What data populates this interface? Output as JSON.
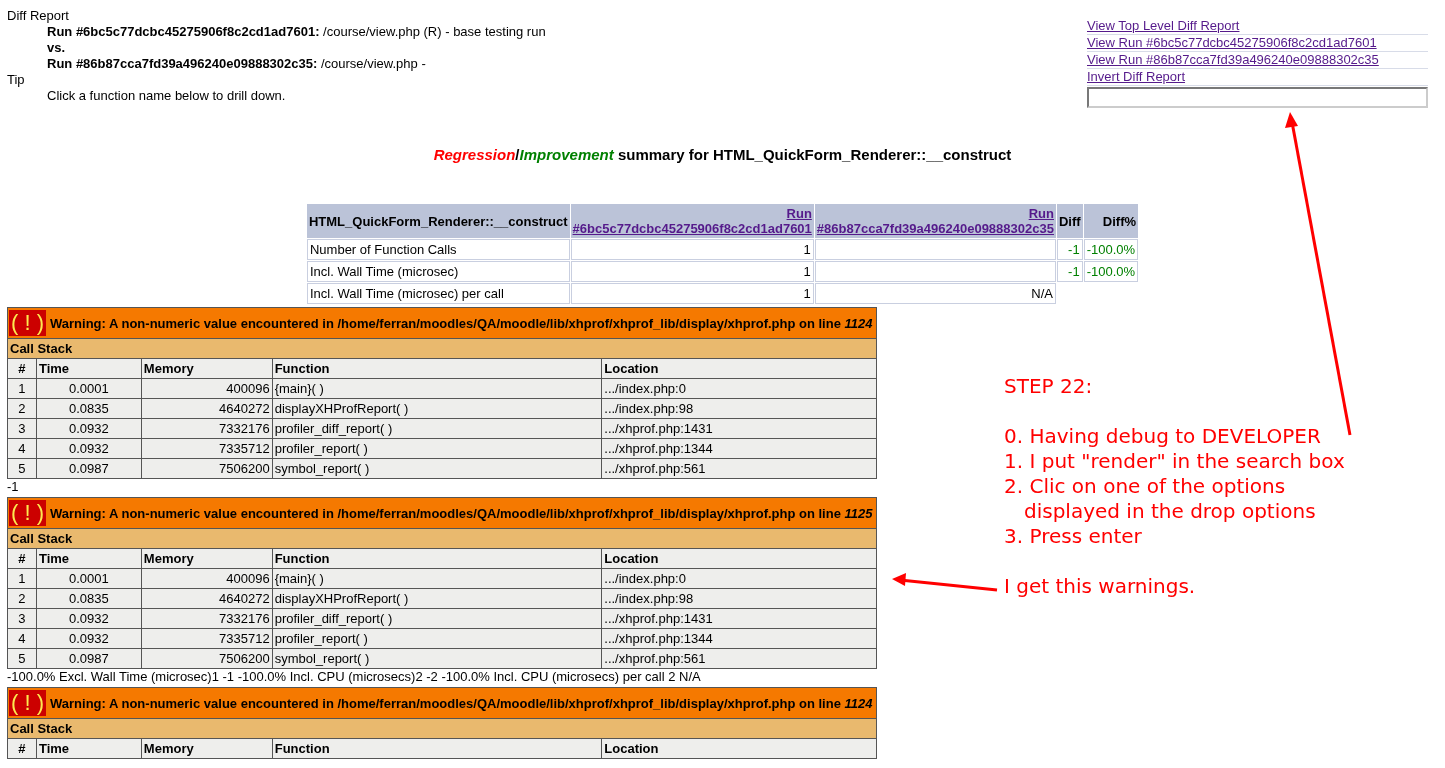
{
  "header": {
    "title": "Diff Report",
    "runs": [
      {
        "label": "Run #6bc5c77dcbc45275906f8c2cd1ad7601:",
        "detail": "/course/view.php (R) - base testing run"
      },
      {
        "label": "Run #86b87cca7fd39a496240e09888302c35:",
        "detail": "/course/view.php -"
      }
    ],
    "versus": "vs.",
    "tip_title": "Tip",
    "tip": "Click a function name below to drill down."
  },
  "nav_links": [
    "View Top Level Diff Report",
    "View Run #6bc5c77dcbc45275906f8c2cd1ad7601",
    "View Run #86b87cca7fd39a496240e09888302c35",
    "Invert Diff Report"
  ],
  "summary_title": {
    "regression": "Regression",
    "separator": "/",
    "improvement": "Improvement",
    "rest": "summary for HTML_QuickForm_Renderer::__construct"
  },
  "summary_table": {
    "columns": [
      {
        "kind": "name",
        "text": "HTML_QuickForm_Renderer::__construct"
      },
      {
        "kind": "run",
        "label": "Run",
        "link": "#6bc5c77dcbc45275906f8c2cd1ad7601"
      },
      {
        "kind": "run",
        "label": "Run",
        "link": "#86b87cca7fd39a496240e09888302c35"
      },
      {
        "kind": "plain",
        "text": "Diff"
      },
      {
        "kind": "plain",
        "text": "Diff%"
      }
    ],
    "rows": [
      [
        "Number of Function Calls",
        "1",
        "",
        "-1",
        "-100.0%"
      ],
      [
        "Incl. Wall Time (microsec)",
        "1",
        "",
        "-1",
        "-100.0%"
      ],
      [
        "Incl. Wall Time (microsec) per call",
        "1",
        "N/A"
      ]
    ]
  },
  "warnings": [
    {
      "icon": "( ! )",
      "message": "Warning: A non-numeric value encountered in /home/ferran/moodles/QA/moodle/lib/xhprof/xhprof_lib/display/xhprof.php on line *1124*",
      "stack_title": "Call Stack",
      "columns": [
        "#",
        "Time",
        "Memory",
        "Function",
        "Location"
      ],
      "rows": [
        [
          "1",
          "0.0001",
          "400096",
          "{main}( )",
          ".../index.php:0"
        ],
        [
          "2",
          "0.0835",
          "4640272",
          "displayXHProfReport( )",
          ".../index.php:98"
        ],
        [
          "3",
          "0.0932",
          "7332176",
          "profiler_diff_report( )",
          ".../xhprof.php:1431"
        ],
        [
          "4",
          "0.0932",
          "7335712",
          "profiler_report( )",
          ".../xhprof.php:1344"
        ],
        [
          "5",
          "0.0987",
          "7506200",
          "symbol_report( )",
          ".../xhprof.php:561"
        ]
      ],
      "trailing": "-1"
    },
    {
      "icon": "( ! )",
      "message": "Warning: A non-numeric value encountered in /home/ferran/moodles/QA/moodle/lib/xhprof/xhprof_lib/display/xhprof.php on line *1125*",
      "stack_title": "Call Stack",
      "columns": [
        "#",
        "Time",
        "Memory",
        "Function",
        "Location"
      ],
      "rows": [
        [
          "1",
          "0.0001",
          "400096",
          "{main}( )",
          ".../index.php:0"
        ],
        [
          "2",
          "0.0835",
          "4640272",
          "displayXHProfReport( )",
          ".../index.php:98"
        ],
        [
          "3",
          "0.0932",
          "7332176",
          "profiler_diff_report( )",
          ".../xhprof.php:1431"
        ],
        [
          "4",
          "0.0932",
          "7335712",
          "profiler_report( )",
          ".../xhprof.php:1344"
        ],
        [
          "5",
          "0.0987",
          "7506200",
          "symbol_report( )",
          ".../xhprof.php:561"
        ]
      ],
      "trailing": "-100.0% Excl. Wall Time (microsec)1 -1 -100.0% Incl. CPU (microsecs)2 -2 -100.0% Incl. CPU (microsecs) per call 2 N/A"
    },
    {
      "icon": "( ! )",
      "message": "Warning: A non-numeric value encountered in /home/ferran/moodles/QA/moodle/lib/xhprof/xhprof_lib/display/xhprof.php on line *1124*",
      "stack_title": "Call Stack",
      "columns": [
        "#",
        "Time",
        "Memory",
        "Function",
        "Location"
      ]
    }
  ],
  "annotation": {
    "heading": "STEP 22:",
    "steps": [
      {
        "text": "0. Having debug to DEVELOPER",
        "continuation": false
      },
      {
        "text": "1. I put \"render\" in the search box",
        "continuation": false
      },
      {
        "text": "2. Clic on one of the options",
        "continuation": false
      },
      {
        "text": "displayed in the drop options",
        "continuation": true
      },
      {
        "text": "3. Press enter",
        "continuation": false
      }
    ],
    "note": "I get this warnings."
  }
}
